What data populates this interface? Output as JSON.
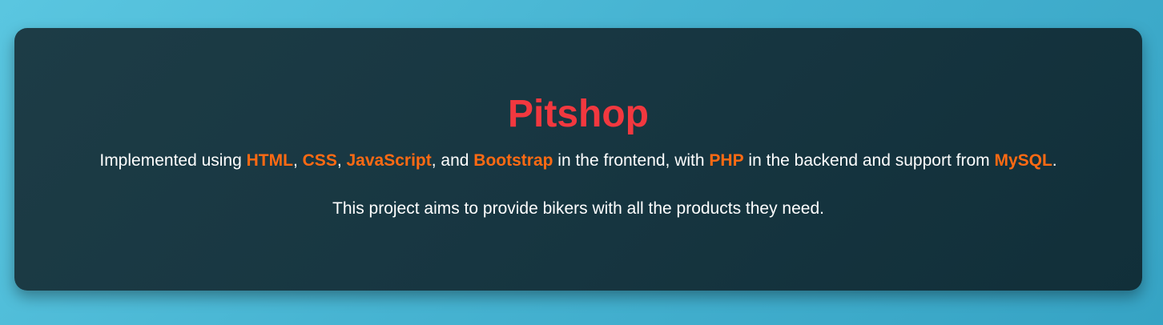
{
  "colors": {
    "background_start": "#5ac6e0",
    "background_end": "#36a3c4",
    "card": "#173641",
    "title": "#f2383f",
    "highlight": "#ff6a13",
    "text": "#ffffff"
  },
  "card": {
    "title": "Pitshop",
    "tech_line": {
      "t1": "Implemented using ",
      "html": "HTML",
      "t2": ", ",
      "css": "CSS",
      "t3": ", ",
      "js": "JavaScript",
      "t4": ", and ",
      "bootstrap": "Bootstrap",
      "t5": " in the frontend, with ",
      "php": "PHP",
      "t6": " in the backend and support from ",
      "mysql": "MySQL",
      "t7": "."
    },
    "aim_line": "This project aims to provide bikers with all the products they need."
  }
}
